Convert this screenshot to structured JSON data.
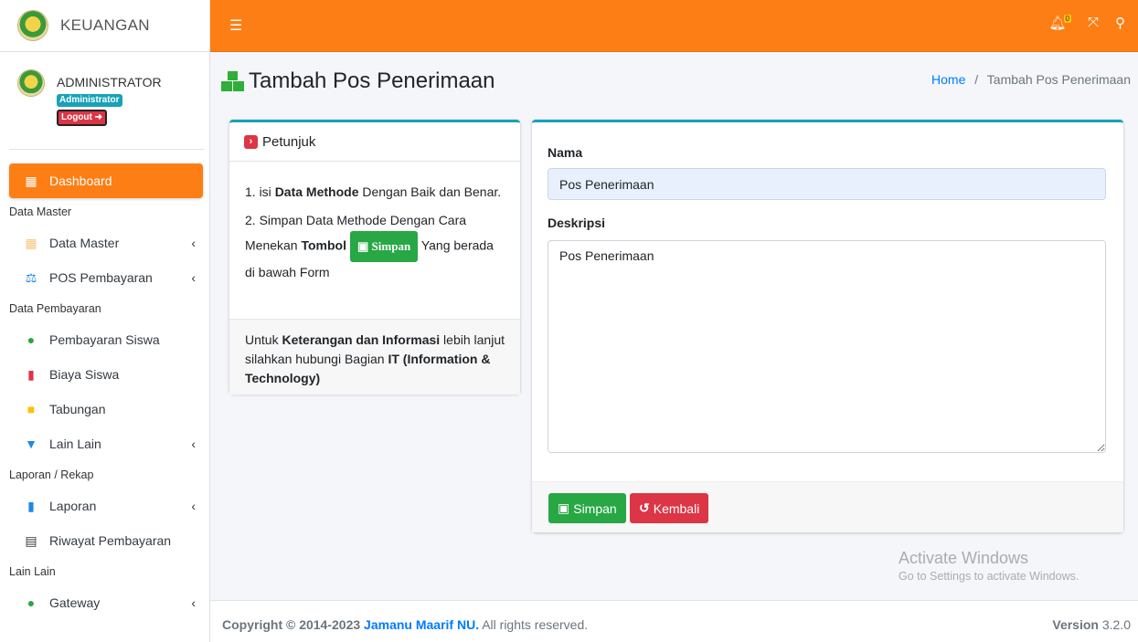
{
  "brand": {
    "title": "KEUANGAN"
  },
  "user": {
    "name": "ADMINISTRATOR",
    "role": "Administrator",
    "logout": "Logout"
  },
  "sidebar": {
    "dashboard": "Dashboard",
    "h_master": "Data Master",
    "data_master": "Data Master",
    "pos_pembayaran": "POS Pembayaran",
    "h_pembayaran": "Data Pembayaran",
    "pembayaran_siswa": "Pembayaran Siswa",
    "biaya_siswa": "Biaya Siswa",
    "tabungan": "Tabungan",
    "lain_lain": "Lain Lain",
    "h_laporan": "Laporan / Rekap",
    "laporan": "Laporan",
    "riwayat": "Riwayat Pembayaran",
    "h_lain": "Lain Lain",
    "gateway": "Gateway"
  },
  "topbar": {
    "notification_count": "0"
  },
  "page": {
    "title": "Tambah Pos Penerimaan"
  },
  "breadcrumb": {
    "home": "Home",
    "sep": "/",
    "current": "Tambah Pos Penerimaan"
  },
  "petunjuk": {
    "title": "Petunjuk",
    "l1_a": "1. isi ",
    "l1_b": "Data Methode",
    "l1_c": " Dengan Baik dan Benar.",
    "l2_a": "2. Simpan Data Methode Dengan Cara Menekan ",
    "l2_b": "Tombol",
    "l2_btn": "Simpan",
    "l2_c": " Yang berada di bawah Form",
    "f_a": "Untuk ",
    "f_b": "Keterangan dan Informasi",
    "f_c": " lebih lanjut silahkan hubungi Bagian ",
    "f_d": "IT (Information & Technology)"
  },
  "form": {
    "nama_label": "Nama",
    "nama_value": "Pos Penerimaan",
    "deskripsi_label": "Deskripsi",
    "deskripsi_value": "Pos Penerimaan",
    "save": "Simpan",
    "back": "Kembali"
  },
  "watermark": {
    "line1": "Activate Windows",
    "line2": "Go to Settings to activate Windows."
  },
  "footer": {
    "copyright": "Copyright © 2014-2023 ",
    "org": "Jamanu Maarif NU.",
    "rights": " All rights reserved.",
    "version_label": "Version",
    "version": "3.2.0"
  },
  "colors": {
    "accent": "#fd7e14",
    "success": "#28a745",
    "danger": "#dc3545",
    "info": "#17a2b8",
    "link": "#007bff"
  }
}
